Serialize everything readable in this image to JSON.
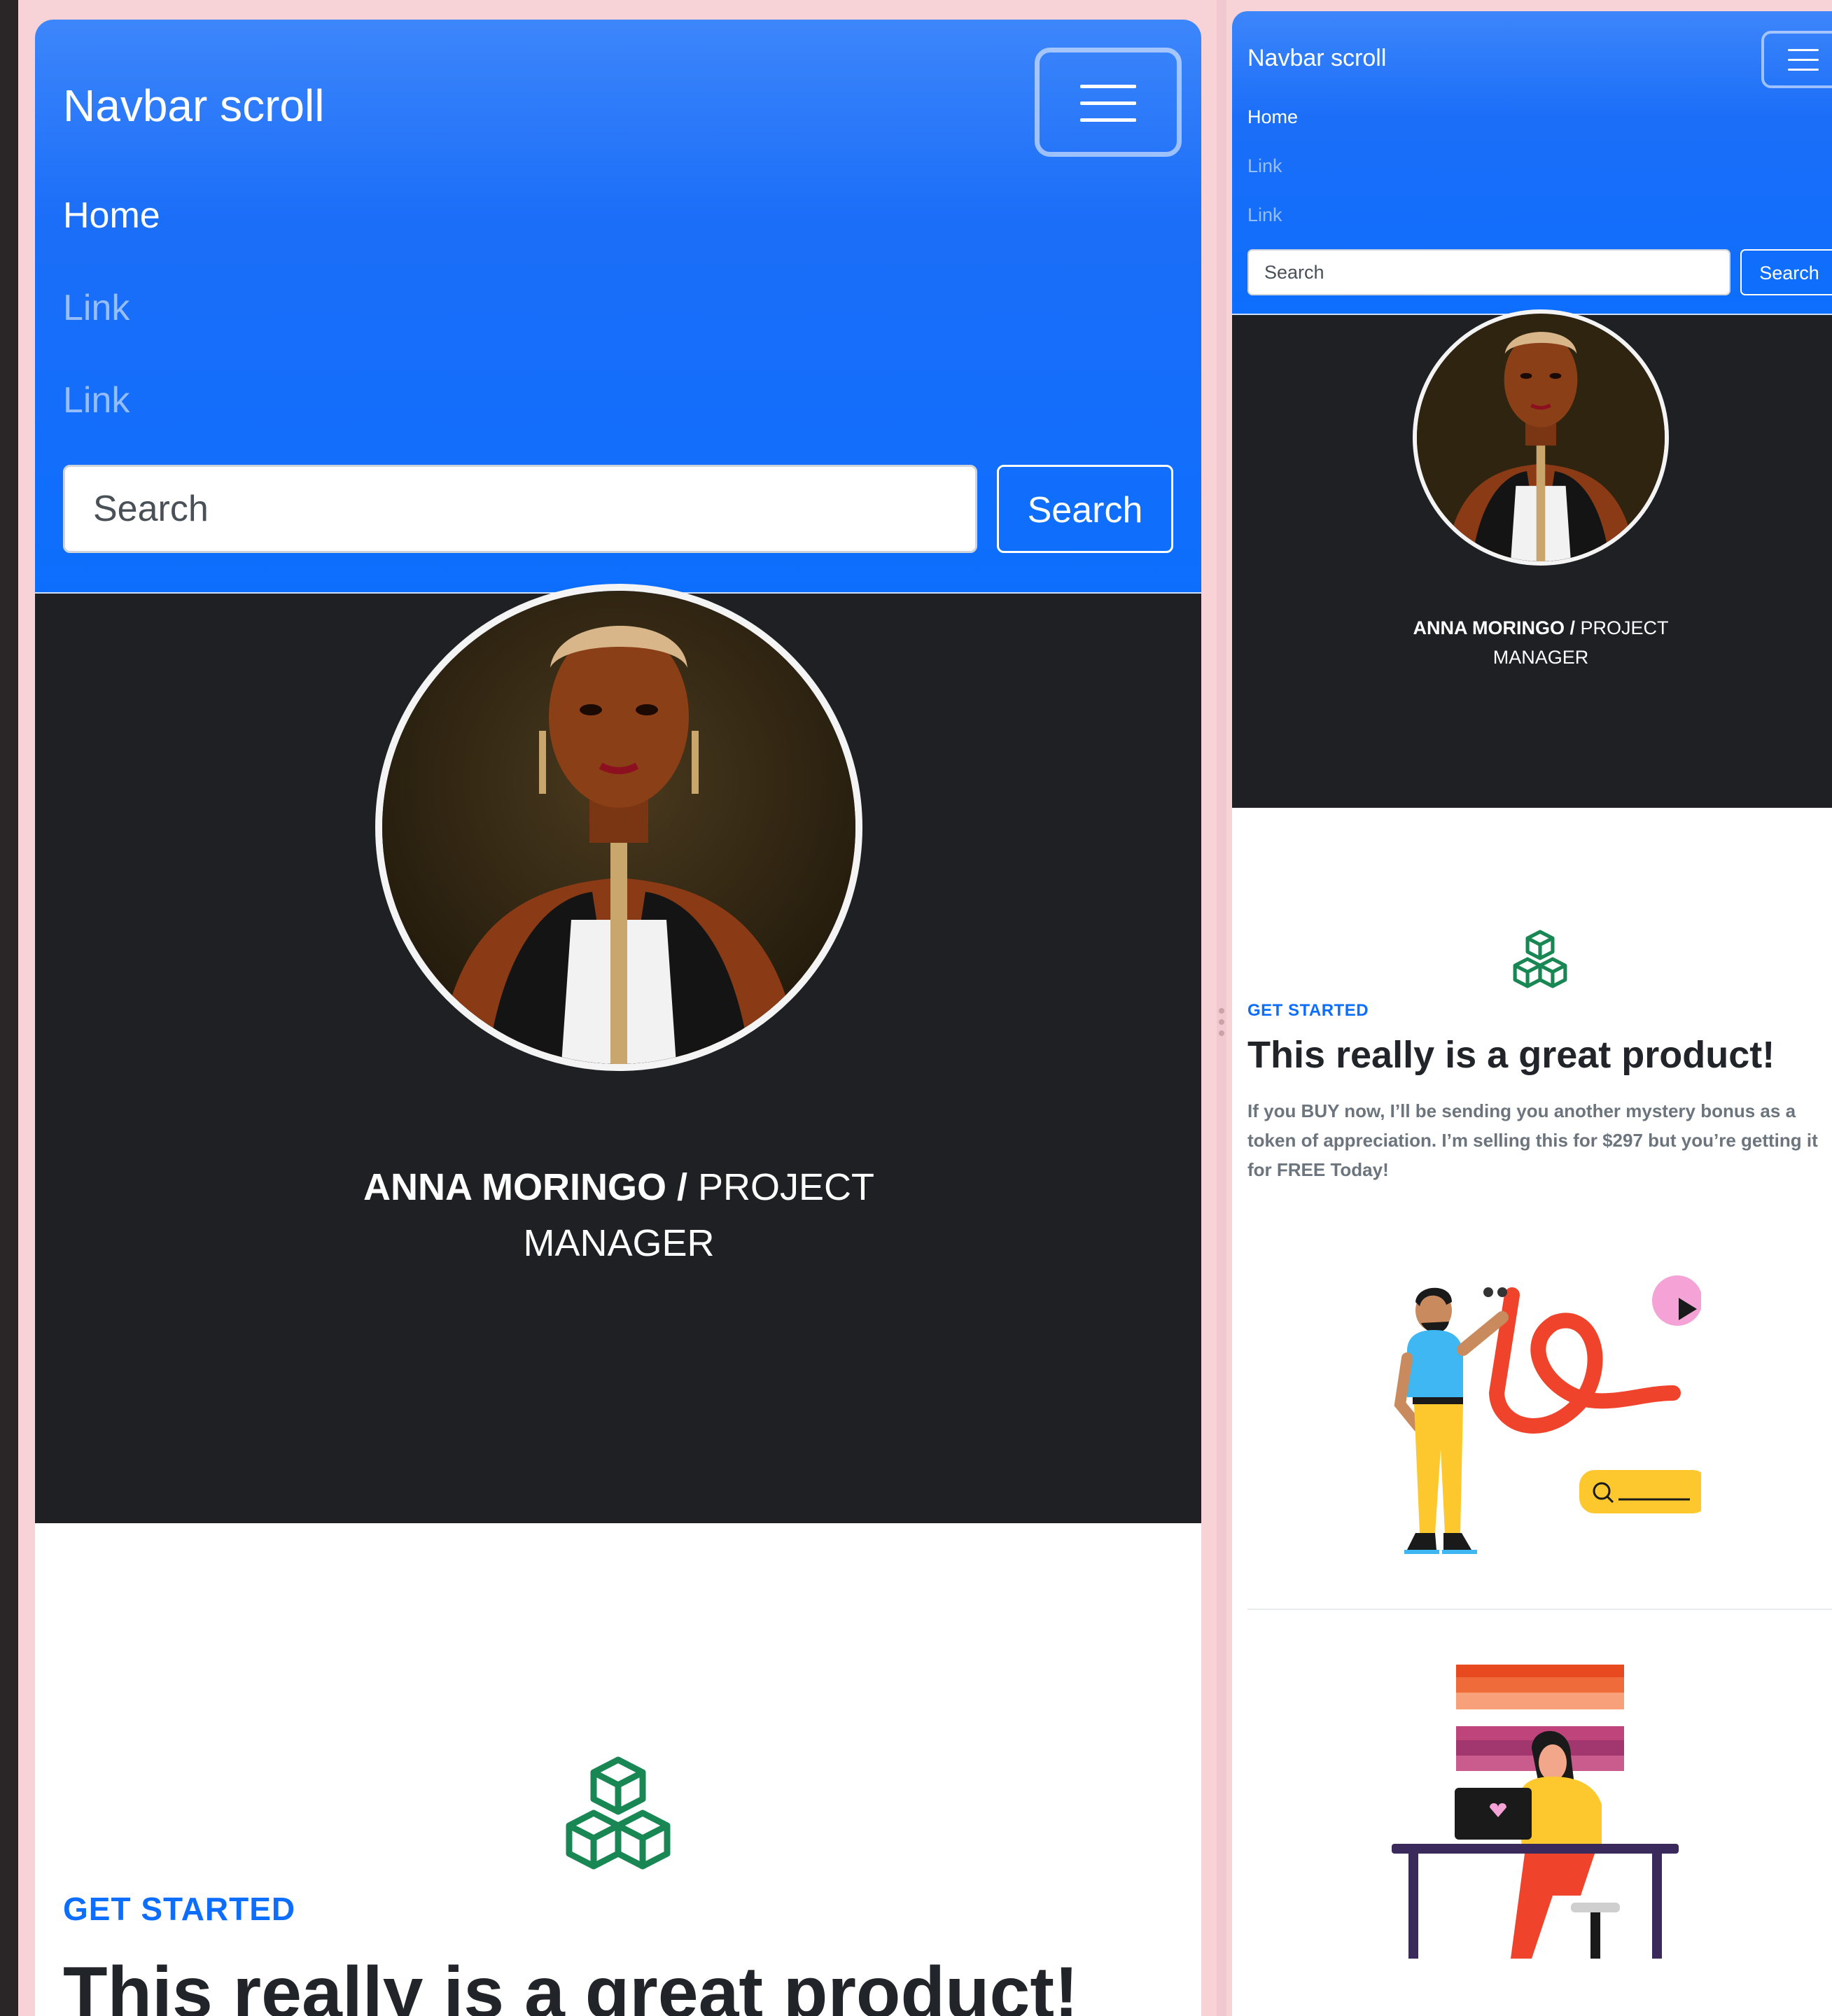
{
  "navbar": {
    "brand": "Navbar scroll",
    "links": [
      {
        "label": "Home",
        "active": true
      },
      {
        "label": "Link",
        "active": false
      },
      {
        "label": "Link",
        "active": false
      }
    ],
    "search_placeholder": "Search",
    "search_button": "Search"
  },
  "profile": {
    "name": "ANNA MORINGO /",
    "role": "PROJECT MANAGER",
    "role_line1": "PROJECT",
    "role_line2": "MANAGER"
  },
  "feature": {
    "icon": "boxes-icon",
    "eyebrow": "GET STARTED",
    "heading": "This really is a great product!",
    "lead": "If you BUY now, I’ll be sending you another mystery bonus as a token of appreciation. I’m selling this for $297 but you’re getting it for FREE Today!"
  },
  "colors": {
    "primary": "#0d6efd",
    "dark": "#1f2023",
    "success": "#198754",
    "window": "#f7d2d6"
  }
}
